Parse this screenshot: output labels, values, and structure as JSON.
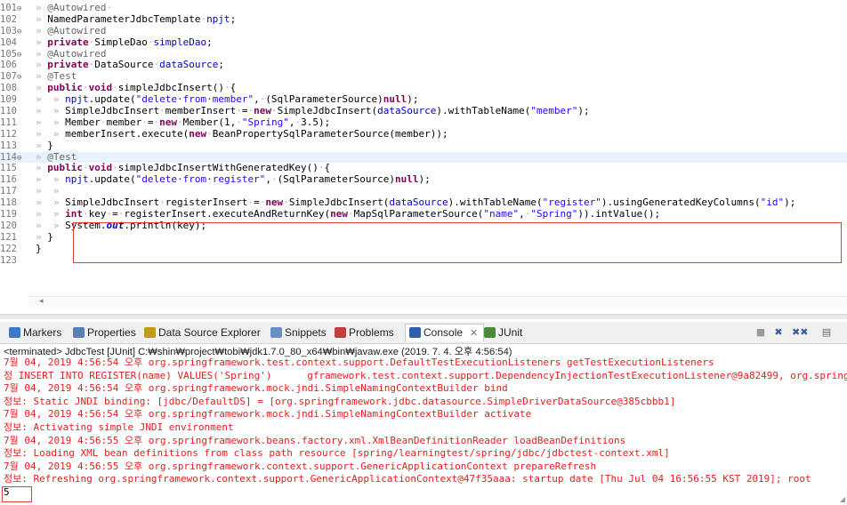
{
  "editor": {
    "lines": [
      {
        "n": "101",
        "fold": "⊖",
        "segs": [
          [
            "ws",
            "» "
          ],
          [
            "ann",
            "@Autowired"
          ],
          [
            "ws",
            "·"
          ]
        ]
      },
      {
        "n": "102",
        "fold": "",
        "segs": [
          [
            "ws",
            "» "
          ],
          [
            "",
            "NamedParameterJdbcTemplate"
          ],
          [
            "ws",
            "·"
          ],
          [
            "fld",
            "npjt"
          ],
          [
            "",
            ";"
          ]
        ]
      },
      {
        "n": "103",
        "fold": "⊖",
        "segs": [
          [
            "ws",
            "» "
          ],
          [
            "ann",
            "@Autowired"
          ]
        ]
      },
      {
        "n": "104",
        "fold": "",
        "segs": [
          [
            "ws",
            "» "
          ],
          [
            "kw",
            "private"
          ],
          [
            "ws",
            "·"
          ],
          [
            "",
            "SimpleDao"
          ],
          [
            "ws",
            "·"
          ],
          [
            "fld",
            "simpleDao"
          ],
          [
            "",
            ";"
          ]
        ]
      },
      {
        "n": "105",
        "fold": "⊖",
        "segs": [
          [
            "ws",
            "» "
          ],
          [
            "ann",
            "@Autowired"
          ]
        ]
      },
      {
        "n": "106",
        "fold": "",
        "segs": [
          [
            "ws",
            "» "
          ],
          [
            "kw",
            "private"
          ],
          [
            "ws",
            "·"
          ],
          [
            "",
            "DataSource"
          ],
          [
            "ws",
            "·"
          ],
          [
            "fld",
            "dataSource"
          ],
          [
            "",
            ";"
          ]
        ]
      },
      {
        "n": "107",
        "fold": "⊖",
        "segs": [
          [
            "ws",
            "» "
          ],
          [
            "ann",
            "@Test"
          ]
        ]
      },
      {
        "n": "108",
        "fold": "",
        "segs": [
          [
            "ws",
            "» "
          ],
          [
            "kw",
            "public"
          ],
          [
            "ws",
            "·"
          ],
          [
            "kw",
            "void"
          ],
          [
            "ws",
            "·"
          ],
          [
            "",
            "simpleJdbcInsert()"
          ],
          [
            "ws",
            "·"
          ],
          [
            "",
            "{"
          ]
        ]
      },
      {
        "n": "109",
        "fold": "",
        "segs": [
          [
            "ws",
            "»  » "
          ],
          [
            "fld",
            "npjt"
          ],
          [
            "",
            ".update("
          ],
          [
            "str",
            "\"delete·from·member\""
          ],
          [
            "",
            ","
          ],
          [
            "ws",
            "·"
          ],
          [
            "",
            "(SqlParameterSource)"
          ],
          [
            "kw",
            "null"
          ],
          [
            "",
            ");"
          ]
        ]
      },
      {
        "n": "110",
        "fold": "",
        "segs": [
          [
            "ws",
            "»  » "
          ],
          [
            "",
            "SimpleJdbcInsert"
          ],
          [
            "ws",
            "·"
          ],
          [
            "",
            "memberInsert"
          ],
          [
            "ws",
            "·"
          ],
          [
            "",
            "="
          ],
          [
            "ws",
            "·"
          ],
          [
            "kw",
            "new"
          ],
          [
            "ws",
            "·"
          ],
          [
            "",
            "SimpleJdbcInsert("
          ],
          [
            "fld",
            "dataSource"
          ],
          [
            "",
            ").withTableName("
          ],
          [
            "str",
            "\"member\""
          ],
          [
            "",
            ");"
          ]
        ]
      },
      {
        "n": "111",
        "fold": "",
        "segs": [
          [
            "ws",
            "»  » "
          ],
          [
            "",
            "Member"
          ],
          [
            "ws",
            "·"
          ],
          [
            "",
            "member"
          ],
          [
            "ws",
            "·"
          ],
          [
            "",
            "="
          ],
          [
            "ws",
            "·"
          ],
          [
            "kw",
            "new"
          ],
          [
            "ws",
            "·"
          ],
          [
            "",
            "Member(1,"
          ],
          [
            "ws",
            "·"
          ],
          [
            "str",
            "\"Spring\""
          ],
          [
            "",
            ","
          ],
          [
            "ws",
            "·"
          ],
          [
            "",
            "3.5);"
          ]
        ]
      },
      {
        "n": "112",
        "fold": "",
        "segs": [
          [
            "ws",
            "»  » "
          ],
          [
            "",
            "memberInsert.execute("
          ],
          [
            "kw",
            "new"
          ],
          [
            "ws",
            "·"
          ],
          [
            "",
            "BeanPropertySqlParameterSource(member));"
          ]
        ]
      },
      {
        "n": "113",
        "fold": "",
        "segs": [
          [
            "ws",
            "» "
          ],
          [
            "",
            "}"
          ]
        ]
      },
      {
        "n": "114",
        "fold": "⊖",
        "segs": [
          [
            "ws",
            "» "
          ],
          [
            "ann",
            "@Test"
          ]
        ]
      },
      {
        "n": "115",
        "fold": "",
        "segs": [
          [
            "ws",
            "» "
          ],
          [
            "kw",
            "public"
          ],
          [
            "ws",
            "·"
          ],
          [
            "kw",
            "void"
          ],
          [
            "ws",
            "·"
          ],
          [
            "",
            "simpleJdbcInsertWithGeneratedKey()"
          ],
          [
            "ws",
            "·"
          ],
          [
            "",
            "{"
          ]
        ]
      },
      {
        "n": "116",
        "fold": "",
        "segs": [
          [
            "ws",
            "»  » "
          ],
          [
            "fld",
            "npjt"
          ],
          [
            "",
            ".update("
          ],
          [
            "str",
            "\"delete·from·register\""
          ],
          [
            "",
            ","
          ],
          [
            "ws",
            "·"
          ],
          [
            "",
            "(SqlParameterSource)"
          ],
          [
            "kw",
            "null"
          ],
          [
            "",
            ");"
          ]
        ]
      },
      {
        "n": "117",
        "fold": "",
        "segs": [
          [
            "ws",
            "»  » "
          ]
        ]
      },
      {
        "n": "118",
        "fold": "",
        "segs": [
          [
            "ws",
            "»  » "
          ],
          [
            "",
            "SimpleJdbcInsert"
          ],
          [
            "ws",
            "·"
          ],
          [
            "",
            "registerInsert"
          ],
          [
            "ws",
            "·"
          ],
          [
            "",
            "="
          ],
          [
            "ws",
            "·"
          ],
          [
            "kw",
            "new"
          ],
          [
            "ws",
            "·"
          ],
          [
            "",
            "SimpleJdbcInsert("
          ],
          [
            "fld",
            "dataSource"
          ],
          [
            "",
            ").withTableName("
          ],
          [
            "str",
            "\"register\""
          ],
          [
            "",
            ").usingGeneratedKeyColumns("
          ],
          [
            "str",
            "\"id\""
          ],
          [
            "",
            ");"
          ]
        ]
      },
      {
        "n": "119",
        "fold": "",
        "segs": [
          [
            "ws",
            "»  » "
          ],
          [
            "kw",
            "int"
          ],
          [
            "ws",
            "·"
          ],
          [
            "",
            "key"
          ],
          [
            "ws",
            "·"
          ],
          [
            "",
            "="
          ],
          [
            "ws",
            "·"
          ],
          [
            "",
            "registerInsert.executeAndReturnKey("
          ],
          [
            "kw",
            "new"
          ],
          [
            "ws",
            "·"
          ],
          [
            "",
            "MapSqlParameterSource("
          ],
          [
            "str",
            "\"name\""
          ],
          [
            "",
            ","
          ],
          [
            "ws",
            "·"
          ],
          [
            "str",
            "\"Spring\""
          ],
          [
            "",
            "))"
          ],
          [
            "",
            ".intValue();"
          ]
        ]
      },
      {
        "n": "120",
        "fold": "",
        "segs": [
          [
            "ws",
            "»  » "
          ],
          [
            "",
            "System."
          ],
          [
            "ital",
            "out"
          ],
          [
            "",
            ".println(key);"
          ]
        ]
      },
      {
        "n": "121",
        "fold": "",
        "segs": [
          [
            "ws",
            "» "
          ],
          [
            "",
            "}"
          ]
        ]
      },
      {
        "n": "122",
        "fold": "",
        "segs": [
          [
            "",
            "}"
          ]
        ]
      },
      {
        "n": "123",
        "fold": "",
        "segs": []
      }
    ],
    "scroll_left_arrow": "◂"
  },
  "views": {
    "tabs": [
      {
        "id": "markers",
        "label": "Markers",
        "icon": "markers-icon",
        "color": "#3a78c9"
      },
      {
        "id": "properties",
        "label": "Properties",
        "icon": "properties-icon",
        "color": "#5a7fb5"
      },
      {
        "id": "dse",
        "label": "Data Source Explorer",
        "icon": "database-icon",
        "color": "#c29a1c"
      },
      {
        "id": "snippets",
        "label": "Snippets",
        "icon": "snippets-icon",
        "color": "#6a8fc2"
      },
      {
        "id": "problems",
        "label": "Problems",
        "icon": "problems-icon",
        "color": "#c04040"
      },
      {
        "id": "console",
        "label": "Console",
        "icon": "console-icon",
        "color": "#2f5fa8",
        "close": "✕"
      },
      {
        "id": "junit",
        "label": "JUnit",
        "icon": "junit-icon",
        "color": "#4a8a3a"
      }
    ],
    "toolbar": [
      "■",
      "✖",
      "✖✖",
      "▤"
    ]
  },
  "console": {
    "terminated": "<terminated> JdbcTest [JUnit] C:₩shin₩project₩tobi₩jdk1.7.0_80_x64₩bin₩javaw.exe (2019. 7. 4. 오후 4:56:54)",
    "lines": [
      {
        "t": "7월 04, 2019 4:56:54 오후 org.springframework.test.context.support.DefaultTestExecutionListeners getTestExecutionListeners",
        "out": false
      },
      {
        "t": "정 INSERT INTO REGISTER(name) VALUES('Spring')      gframework.test.context.support.DependencyInjectionTestExecutionListener@9a82499, org.springf",
        "out": false
      },
      {
        "t": "7월 04, 2019 4:56:54 오후 org.springframework.mock.jndi.SimpleNamingContextBuilder bind",
        "out": false
      },
      {
        "t": "정보: Static JNDI binding: [jdbc/DefaultDS] = [org.springframework.jdbc.datasource.SimpleDriverDataSource@385cbbb1]",
        "out": false
      },
      {
        "t": "7월 04, 2019 4:56:54 오후 org.springframework.mock.jndi.SimpleNamingContextBuilder activate",
        "out": false
      },
      {
        "t": "정보: Activating simple JNDI environment",
        "out": false
      },
      {
        "t": "7월 04, 2019 4:56:55 오후 org.springframework.beans.factory.xml.XmlBeanDefinitionReader loadBeanDefinitions",
        "out": false
      },
      {
        "t": "정보: Loading XML bean definitions from class path resource [spring/learningtest/spring/jdbc/jdbctest-context.xml]",
        "out": false
      },
      {
        "t": "7월 04, 2019 4:56:55 오후 org.springframework.context.support.GenericApplicationContext prepareRefresh",
        "out": false
      },
      {
        "t": "정보: Refreshing org.springframework.context.support.GenericApplicationContext@47f35aaa: startup date [Thu Jul 04 16:56:55 KST 2019]; root",
        "out": false
      },
      {
        "t": "5",
        "out": true
      }
    ]
  },
  "colors": {
    "highlight_box": "#e03c3c",
    "error_text": "#e02020"
  }
}
